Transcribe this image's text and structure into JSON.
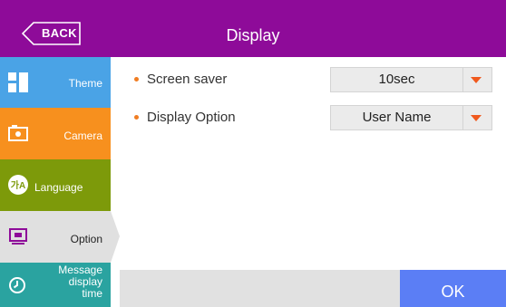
{
  "header": {
    "back_label": "BACK",
    "title": "Display",
    "background_color": "#8e0b99"
  },
  "sidebar": {
    "items": [
      {
        "label": "Theme",
        "icon": "theme-icon",
        "color": "#4aa3e6"
      },
      {
        "label": "Camera",
        "icon": "camera-icon",
        "color": "#f7901e"
      },
      {
        "label": "Language",
        "icon": "language-icon",
        "color": "#7d9a0a"
      },
      {
        "label": "Option",
        "icon": "option-icon",
        "color": "#e0e0e0",
        "selected": true
      },
      {
        "label_lines": [
          "Message",
          "display",
          "time"
        ],
        "icon": "clock-icon",
        "color": "#2aa3a0"
      }
    ]
  },
  "settings": {
    "screen_saver": {
      "label": "Screen saver",
      "value": "10sec"
    },
    "display_option": {
      "label": "Display Option",
      "value": "User Name"
    }
  },
  "footer": {
    "ok_label": "OK",
    "ok_color": "#5b7ef5"
  },
  "accent_color": "#f07d22"
}
